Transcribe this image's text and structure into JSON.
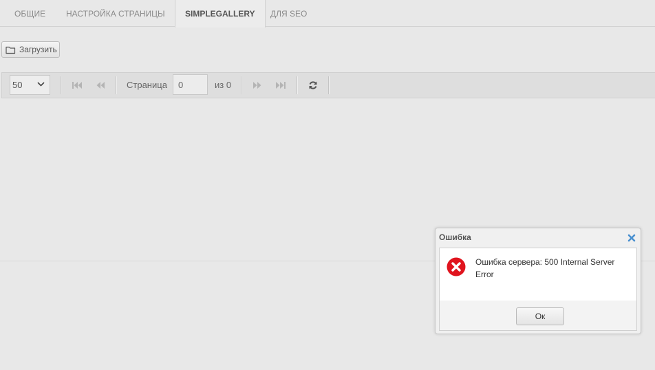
{
  "tabs": [
    {
      "label": "ОБЩИЕ",
      "active": false
    },
    {
      "label": "НАСТРОЙКА СТРАНИЦЫ",
      "active": false
    },
    {
      "label": "SIMPLEGALLERY",
      "active": true
    },
    {
      "label": "ДЛЯ SEO",
      "active": false
    }
  ],
  "toolbar": {
    "upload_label": "Загрузить",
    "upload_icon": "folder-icon"
  },
  "pager": {
    "page_size": "50",
    "page_label": "Страница",
    "page_value": "0",
    "of_label": "из 0",
    "icons": [
      "first-page-icon",
      "prev-page-icon",
      "next-page-icon",
      "last-page-icon",
      "refresh-icon"
    ]
  },
  "dialog": {
    "title": "Ошибка",
    "message": "Ошибка сервера: 500 Internal Server Error",
    "ok_label": "Ок",
    "error_color": "#e0141e",
    "close_color": "#4a90d0"
  }
}
